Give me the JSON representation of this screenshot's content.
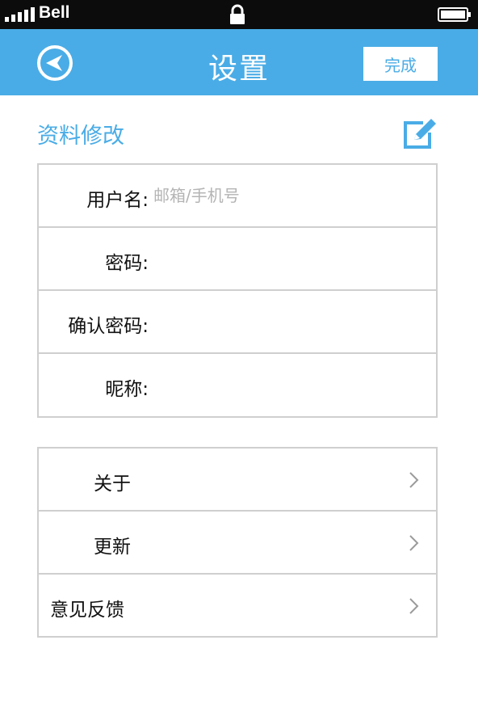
{
  "status_bar": {
    "carrier": "Bell",
    "icons": [
      "signal-icon",
      "lock-icon",
      "battery-icon"
    ]
  },
  "nav": {
    "title": "设置",
    "done_label": "完成",
    "back_icon": "back-arrow-icon"
  },
  "profile": {
    "section_title": "资料修改",
    "edit_icon": "edit-icon",
    "fields": [
      {
        "label": "用户名:",
        "placeholder": "邮箱/手机号",
        "value": ""
      },
      {
        "label": "密码:",
        "placeholder": "",
        "value": ""
      },
      {
        "label": "确认密码:",
        "placeholder": "",
        "value": ""
      },
      {
        "label": "昵称:",
        "placeholder": "",
        "value": ""
      }
    ]
  },
  "menu": {
    "items": [
      {
        "label": "关于",
        "icon": "chevron-right-icon"
      },
      {
        "label": "更新",
        "icon": "chevron-right-icon"
      },
      {
        "label": "意见反馈",
        "icon": "chevron-right-icon"
      }
    ]
  },
  "colors": {
    "accent": "#4aace6",
    "status_bar": "#0c0c0c",
    "border": "#cfcfcf",
    "placeholder": "#b4b4b4"
  }
}
